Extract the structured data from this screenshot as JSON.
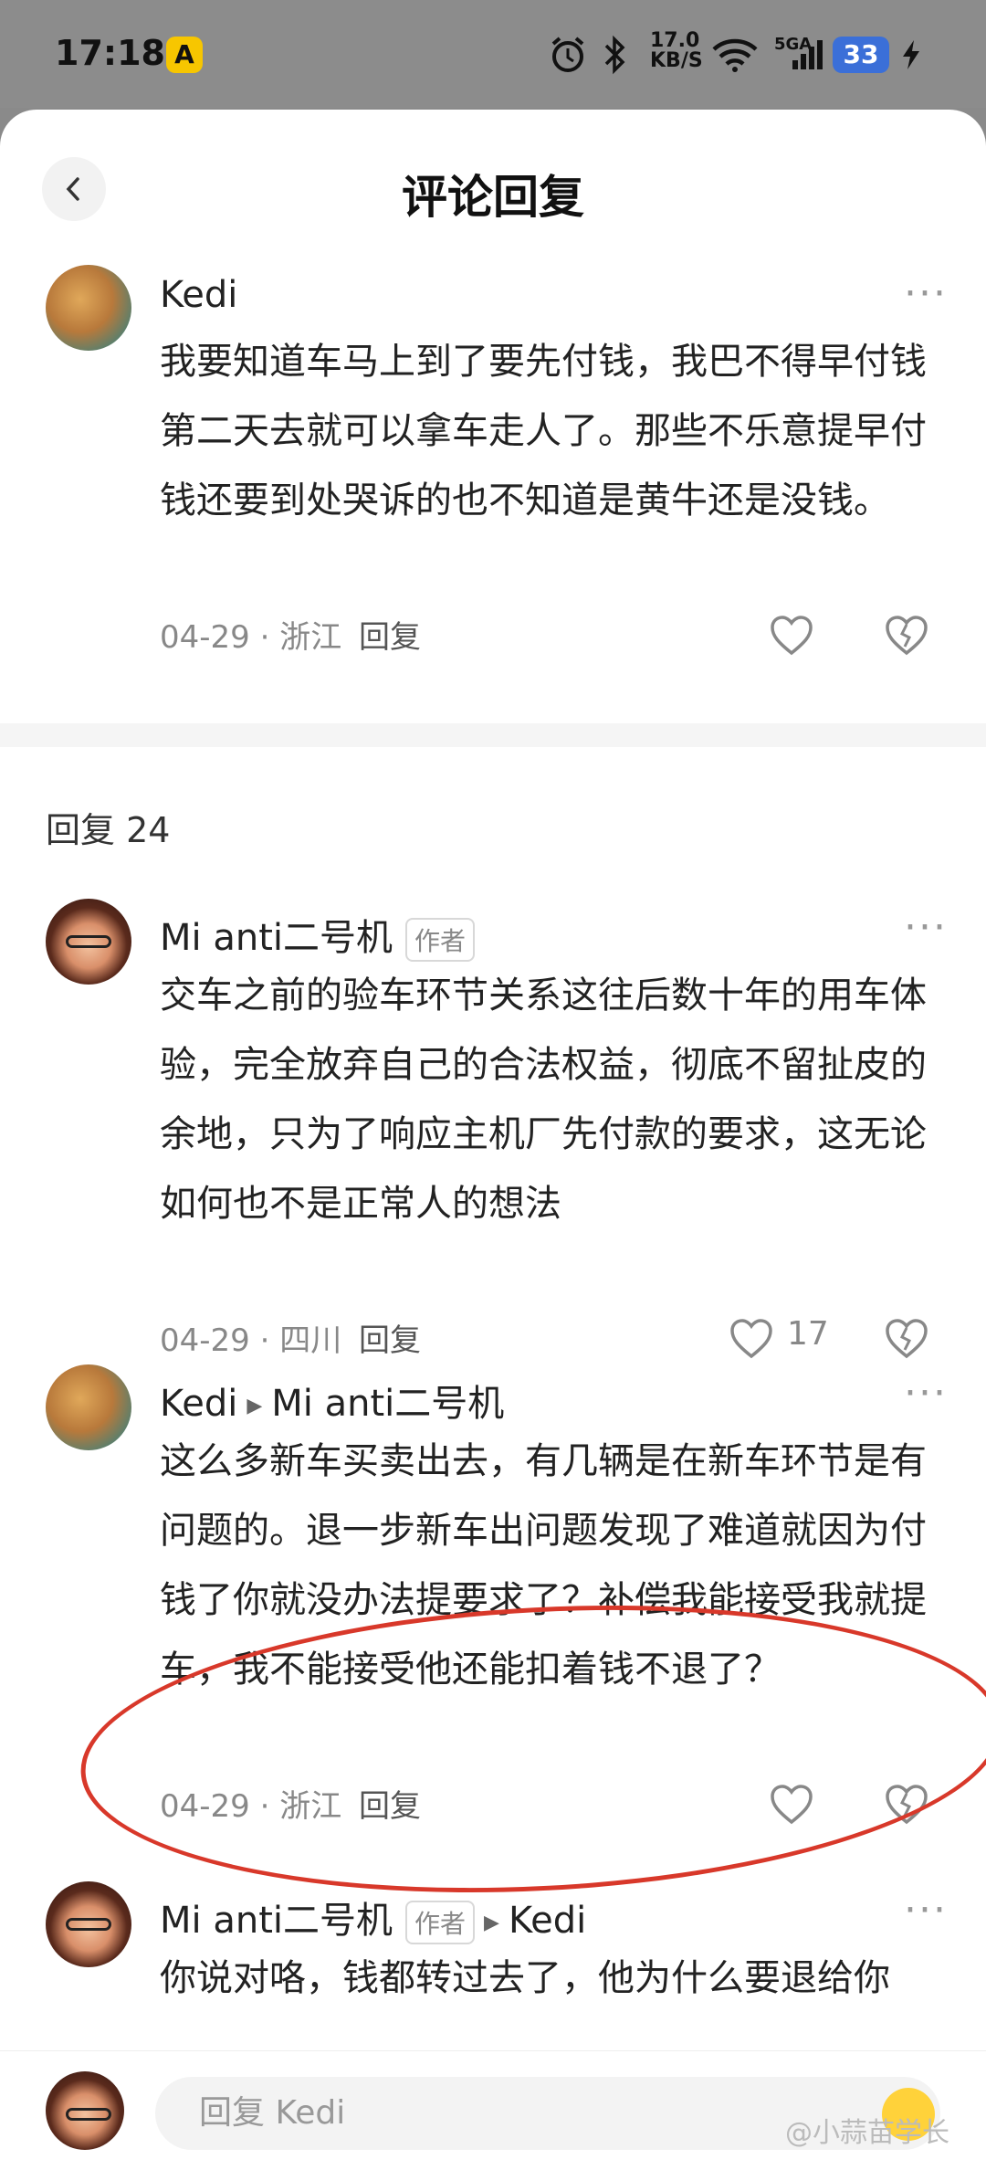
{
  "status_bar": {
    "time": "17:18",
    "app_icon_letter": "A",
    "net_speed": "17.0 KB/S",
    "network": "5GA",
    "battery": "33"
  },
  "header": {
    "title": "评论回复"
  },
  "main_comment": {
    "user": "Kedi",
    "text": "我要知道车马上到了要先付钱，我巴不得早付钱第二天去就可以拿车走人了。那些不乐意提早付钱还要到处哭诉的也不知道是黄牛还是没钱。",
    "date_loc": "04-29 · 浙江",
    "reply_label": "回复"
  },
  "replies_header": "回复 24",
  "replies": [
    {
      "user": "Mi anti二号机",
      "tag": "作者",
      "text": "交车之前的验车环节关系这往后数十年的用车体验，完全放弃自己的合法权益，彻底不留扯皮的余地，只为了响应主机厂先付款的要求，这无论如何也不是正常人的想法",
      "date_loc": "04-29 · 四川",
      "reply_label": "回复",
      "likes": "17"
    },
    {
      "user": "Kedi",
      "reply_to": "Mi anti二号机",
      "text": "这么多新车买卖出去，有几辆是在新车环节是有问题的。退一步新车出问题发现了难道就因为付钱了你就没办法提要求了？补偿我能接受我就提车，我不能接受他还能扣着钱不退了？",
      "date_loc": "04-29 · 浙江",
      "reply_label": "回复"
    },
    {
      "user": "Mi anti二号机",
      "tag": "作者",
      "reply_to": "Kedi",
      "text": "你说对咯，钱都转过去了，他为什么要退给你"
    }
  ],
  "bottom": {
    "input_placeholder": "回复 Kedi",
    "watermark": "@小蒜苗学长"
  },
  "colors": {
    "annotation_circle": "#d8382a",
    "battery": "#3b6fd8"
  }
}
